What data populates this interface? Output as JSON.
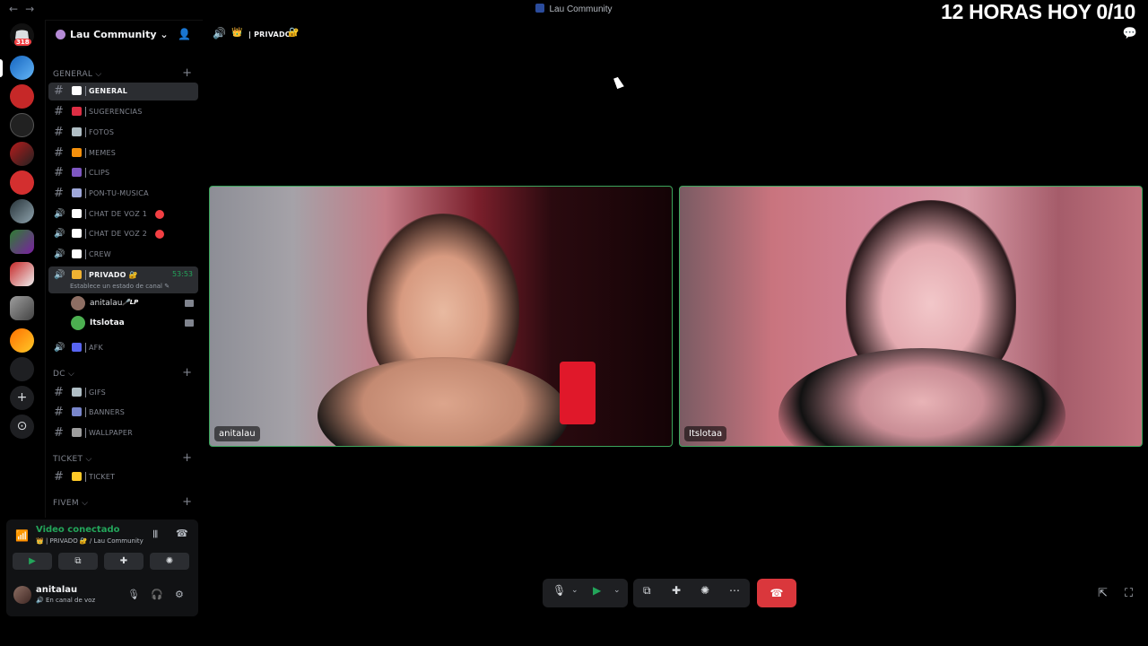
{
  "titlebar": {
    "back": "←",
    "forward": "→",
    "title": "Lau Community"
  },
  "overlay": {
    "text": "12 HORAS HOY 0/10"
  },
  "rail": {
    "home_badge": "318"
  },
  "guild": {
    "name": "Lau Community"
  },
  "categories": [
    {
      "name": "GENERAL",
      "caret": "⌵"
    },
    {
      "name": "DC",
      "caret": "⌵"
    },
    {
      "name": "TICKET",
      "caret": "⌵"
    },
    {
      "name": "FIVEM",
      "caret": "⌵"
    }
  ],
  "channels": [
    {
      "type": "text",
      "label": "GENERAL",
      "emoji_color": "#ffffff",
      "active": true
    },
    {
      "type": "text",
      "label": "SUGERENCIAS",
      "emoji_color": "#dd2e44"
    },
    {
      "type": "text",
      "label": "FOTOS",
      "emoji_color": "#b0bec5"
    },
    {
      "type": "text",
      "label": "MEMES",
      "emoji_color": "#f4900c"
    },
    {
      "type": "text",
      "label": "CLIPS",
      "emoji_color": "#7e57c2"
    },
    {
      "type": "text",
      "label": "PON-TU-MUSICA",
      "emoji_color": "#9fa8da"
    },
    {
      "type": "voice",
      "label": "CHAT DE VOZ 1",
      "emoji_color": "#ffffff",
      "dot": true
    },
    {
      "type": "voice",
      "label": "CHAT DE VOZ 2",
      "emoji_color": "#ffffff",
      "dot": true
    },
    {
      "type": "voice",
      "label": "CREW",
      "emoji_color": "#ffffff"
    },
    {
      "type": "voice",
      "label": "PRIVADO 🔐",
      "emoji_color": "#f0b232",
      "active": true,
      "timer": "53:53",
      "status": "Establece un estado de canal ✎"
    },
    {
      "type": "voice",
      "label": "AFK",
      "emoji_color": "#5865f2"
    },
    {
      "type": "text",
      "label": "GIFS",
      "emoji_color": "#b0bec5"
    },
    {
      "type": "text",
      "label": "BANNERS",
      "emoji_color": "#7986cb"
    },
    {
      "type": "text",
      "label": "WALLPAPER",
      "emoji_color": "#9e9e9e"
    },
    {
      "type": "text",
      "label": "TICKET",
      "emoji_color": "#ffca28"
    }
  ],
  "voice_users": [
    {
      "name": "anitalau",
      "tag": "🎤LP",
      "avatar": "#8d6e63"
    },
    {
      "name": "Itslotaa",
      "tag": "",
      "avatar": "#4caf50"
    }
  ],
  "voice_panel": {
    "state": "Video conectado",
    "where": "👑 | PRIVADO 🔐 / Lau Community"
  },
  "user_panel": {
    "name": "anitalau",
    "status": "🔊 En canal de voz"
  },
  "main": {
    "channel_title": "| PRIVADO",
    "tiles": [
      {
        "name": "anitalau"
      },
      {
        "name": "Itslotaa"
      }
    ]
  },
  "icons": {
    "invite": "👤",
    "speaker": "🔊",
    "crown": "👑",
    "gift": "🔐",
    "chat": "💬",
    "signal": "📶",
    "wave": "𝄃𝄃",
    "hang": "☎",
    "camera": "▶",
    "screen": "⧉",
    "activity": "✚",
    "soundboard": "✺",
    "mic": "🎙",
    "headset": "🎧",
    "gear": "⚙",
    "more": "⋯",
    "popout": "⇱",
    "fullscreen": "⛶",
    "caret": "⌄",
    "plus": "+",
    "add": "+",
    "discover": "⊙"
  }
}
